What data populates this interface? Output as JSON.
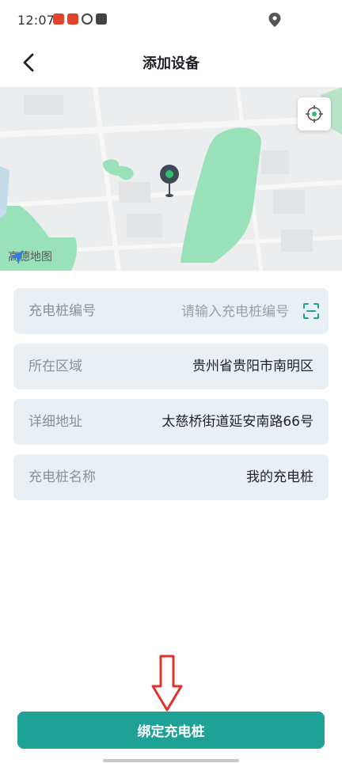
{
  "status_bar": {
    "time": "12:07",
    "app_icons": [
      "red-app-icon",
      "red-app-icon",
      "sync-icon",
      "bag-icon"
    ],
    "location_icon": "location-pin-icon"
  },
  "header": {
    "title": "添加设备",
    "back_icon": "back-arrow-icon"
  },
  "map": {
    "provider_label": "高德地图",
    "locate_icon": "locate-target-icon",
    "marker_icon": "map-marker-icon",
    "land_color": "#ecedee",
    "park_color": "#98e1b9"
  },
  "form": {
    "pile_number": {
      "label": "充电桩编号",
      "placeholder": "请输入充电桩编号",
      "value": ""
    },
    "region": {
      "label": "所在区域",
      "value": "贵州省贵阳市南明区"
    },
    "address": {
      "label": "详细地址",
      "value": "太慈桥街道延安南路66号"
    },
    "pile_name": {
      "label": "充电桩名称",
      "value": "我的充电桩"
    }
  },
  "actions": {
    "bind_label": "绑定充电桩",
    "accent_color": "#1ea296",
    "annotation_arrow_color": "#e0322c"
  }
}
